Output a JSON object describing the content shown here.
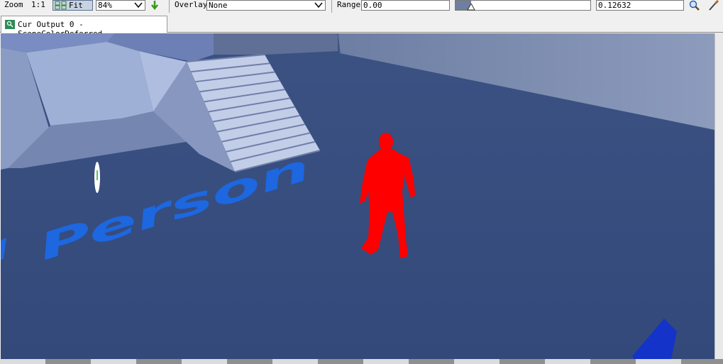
{
  "toolbar": {
    "zoom_label": "Zoom",
    "zoom_ratio": "1:1",
    "fit_label": "Fit",
    "zoom_percent": "84%",
    "overlay_label": "Overlay",
    "overlay_value": "None",
    "range_label": "Range",
    "range_min": "0.00",
    "range_max": "0.12632"
  },
  "tab": {
    "title": "Cur Output 0 - SceneColorDeferred"
  },
  "scene": {
    "floor_text": "Person"
  },
  "colors": {
    "floor": "#33497a",
    "wall": "#8a9ac0",
    "character": "#ff0000",
    "floor_text": "#1d67e0"
  }
}
